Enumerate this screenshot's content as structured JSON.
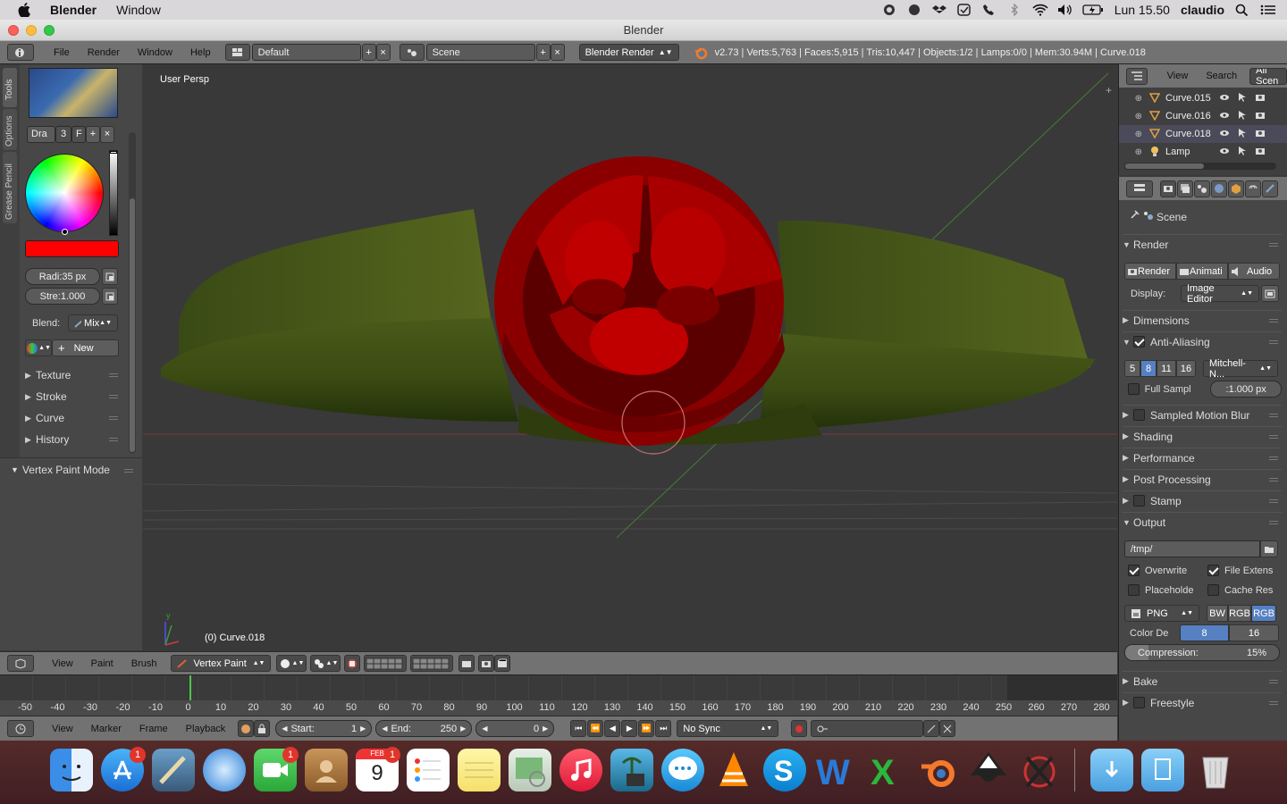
{
  "mac_menubar": {
    "app_name": "Blender",
    "menu_window": "Window",
    "clock": "Lun 15.50",
    "user": "claudio"
  },
  "window": {
    "title": "Blender"
  },
  "info_header": {
    "menus": [
      "File",
      "Render",
      "Window",
      "Help"
    ],
    "layout": "Default",
    "scene": "Scene",
    "engine": "Blender Render",
    "stats": "v2.73 | Verts:5,763 | Faces:5,915 | Tris:10,447 | Objects:1/2 | Lamps:0/0 | Mem:30.94M | Curve.018"
  },
  "tool_shelf": {
    "tabs": [
      "Tools",
      "Options",
      "Grease Pencil"
    ],
    "brush_name": "Dra",
    "brush_users": "3",
    "brush_fake": "F",
    "radius": "Radi:35 px",
    "strength": "Stre:1.000",
    "blend_label": "Blend:",
    "blend_value": "Mix",
    "new_button": "New",
    "color": "#ff0000",
    "sections": [
      "Texture",
      "Stroke",
      "Curve",
      "History"
    ]
  },
  "operator_panel": {
    "title": "Vertex Paint Mode"
  },
  "viewport": {
    "view_label": "User Persp",
    "object_label": "(0) Curve.018"
  },
  "viewport_header": {
    "menus": [
      "View",
      "Paint",
      "Brush"
    ],
    "mode": "Vertex Paint"
  },
  "timeline": {
    "ruler": [
      "-50",
      "-40",
      "-30",
      "-20",
      "-10",
      "0",
      "10",
      "20",
      "30",
      "40",
      "50",
      "60",
      "70",
      "80",
      "90",
      "100",
      "110",
      "120",
      "130",
      "140",
      "150",
      "160",
      "170",
      "180",
      "190",
      "200",
      "210",
      "220",
      "230",
      "240",
      "250",
      "260",
      "270",
      "280"
    ],
    "menus": [
      "View",
      "Marker",
      "Frame",
      "Playback"
    ],
    "start_label": "Start:",
    "start": "1",
    "end_label": "End:",
    "end": "250",
    "current": "0",
    "sync": "No Sync"
  },
  "outliner": {
    "menus": [
      "View",
      "Search"
    ],
    "filter": "All Scen",
    "items": [
      {
        "name": "Curve.015"
      },
      {
        "name": "Curve.016"
      },
      {
        "name": "Curve.018"
      },
      {
        "name": "Lamp"
      }
    ]
  },
  "properties": {
    "context": "Scene",
    "render_section": "Render",
    "render_buttons": [
      "Render",
      "Animati",
      "Audio"
    ],
    "display_label": "Display:",
    "display_value": "Image Editor",
    "dimensions": "Dimensions",
    "antialiasing": "Anti-Aliasing",
    "aa_samples": [
      "5",
      "8",
      "11",
      "16"
    ],
    "aa_filter": "Mitchell-N...",
    "full_sample": "Full Sampl",
    "filter_size": ":1.000 px",
    "sampled_motion_blur": "Sampled Motion Blur",
    "shading": "Shading",
    "performance": "Performance",
    "post_processing": "Post Processing",
    "stamp": "Stamp",
    "output": "Output",
    "output_path": "/tmp/",
    "overwrite": "Overwrite",
    "file_extensions": "File Extens",
    "placeholders": "Placeholde",
    "cache_result": "Cache Res",
    "file_format": "PNG",
    "color_modes": [
      "BW",
      "RGB",
      "RGB"
    ],
    "color_depth_label": "Color De",
    "color_depths": [
      "8",
      "16"
    ],
    "compression_label": "Compression:",
    "compression": "15%",
    "bake": "Bake",
    "freestyle": "Freestyle"
  },
  "dock": {
    "badges": {
      "appstore": "1",
      "facetime": "1",
      "calendar": "1"
    },
    "calendar_month": "FEB",
    "calendar_day": "9"
  }
}
